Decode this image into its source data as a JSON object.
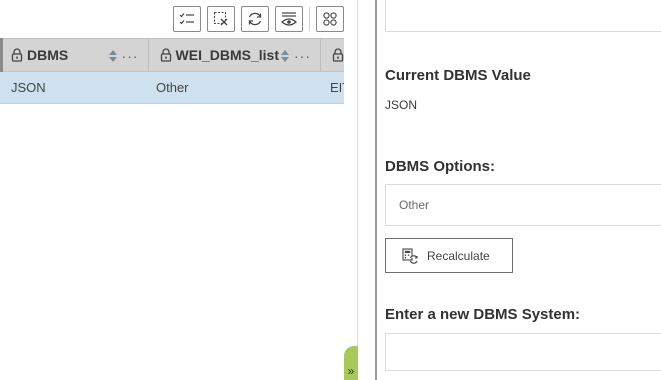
{
  "toolbar": {
    "icons": [
      "select-all-icon",
      "clear-selection-icon",
      "refresh-icon",
      "show-hide-icon",
      "grid-view-icon"
    ]
  },
  "table": {
    "columns": [
      {
        "label": "DBMS"
      },
      {
        "label": "WEI_DBMS_list"
      },
      {
        "label": ""
      }
    ],
    "rows": [
      {
        "dbms": "JSON",
        "wei_dbms_list": "Other",
        "extra": "EIT"
      }
    ],
    "more_glyph": "···"
  },
  "form": {
    "current_title": "Current DBMS Value",
    "current_value": "JSON",
    "options_title": "DBMS Options:",
    "options_selected": "Other",
    "recalculate_label": "Recalculate",
    "new_title": "Enter a new DBMS System:",
    "new_value": ""
  },
  "splitter": {
    "glyph": "»"
  },
  "colors": {
    "header": "#d4d4d4",
    "selected_row": "#cde1ef",
    "accent_tab": "#a8c85a"
  }
}
